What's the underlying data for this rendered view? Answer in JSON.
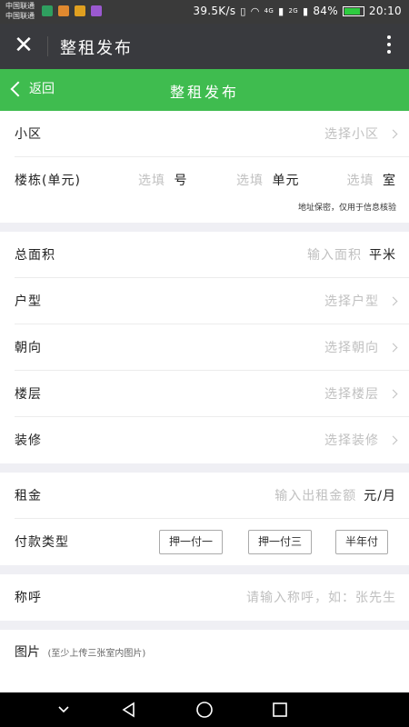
{
  "status_bar": {
    "carrier1": "中国联通",
    "carrier2": "中国联通",
    "speed": "39.5K/s",
    "net_4g": "4G",
    "net_2g": "2G",
    "battery": "84%",
    "battery_level": 0.84,
    "time": "20:10"
  },
  "wx_header": {
    "title": "整租发布"
  },
  "page_header": {
    "back_label": "返回",
    "title": "整租发布"
  },
  "section1": {
    "community_label": "小区",
    "community_placeholder": "选择小区",
    "building_label": "楼栋(单元)",
    "building_pick": "选填",
    "building_unit": "号",
    "unit_pick": "选填",
    "unit_unit": "单元",
    "room_pick": "选填",
    "room_unit": "室",
    "note": "地址保密，仅用于信息核验"
  },
  "section2": {
    "area_label": "总面积",
    "area_placeholder": "输入面积",
    "area_unit": "平米",
    "layout_label": "户型",
    "layout_placeholder": "选择户型",
    "orientation_label": "朝向",
    "orientation_placeholder": "选择朝向",
    "floor_label": "楼层",
    "floor_placeholder": "选择楼层",
    "decoration_label": "装修",
    "decoration_placeholder": "选择装修"
  },
  "section3": {
    "rent_label": "租金",
    "rent_placeholder": "输入出租金额",
    "rent_unit": "元/月",
    "payment_label": "付款类型",
    "payment_options": [
      "押一付一",
      "押一付三",
      "半年付"
    ]
  },
  "section4": {
    "name_label": "称呼",
    "name_placeholder": "请输入称呼，如：张先生"
  },
  "section5": {
    "photo_label": "图片",
    "photo_hint": "(至少上传三张室内图片)"
  },
  "colors": {
    "green": "#3fbc4f",
    "wx_header": "#393a3e",
    "placeholder": "#c0c0c0"
  }
}
